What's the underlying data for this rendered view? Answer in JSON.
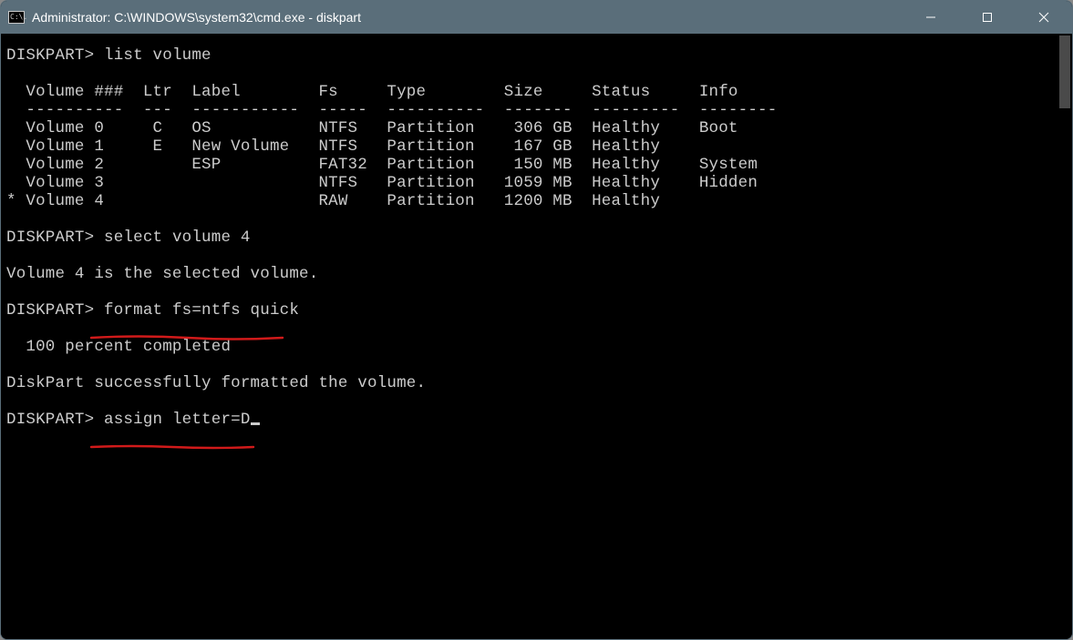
{
  "window": {
    "title": "Administrator: C:\\WINDOWS\\system32\\cmd.exe - diskpart",
    "icon_text": "C:\\."
  },
  "term": {
    "prompt": "DISKPART>",
    "cmd_list": "list volume",
    "header": "  Volume ###  Ltr  Label        Fs     Type        Size     Status     Info",
    "divider": "  ----------  ---  -----------  -----  ----------  -------  ---------  --------",
    "rows": [
      "  Volume 0     C   OS           NTFS   Partition    306 GB  Healthy    Boot",
      "  Volume 1     E   New Volume   NTFS   Partition    167 GB  Healthy",
      "  Volume 2         ESP          FAT32  Partition    150 MB  Healthy    System",
      "  Volume 3                      NTFS   Partition   1059 MB  Healthy    Hidden",
      "* Volume 4                      RAW    Partition   1200 MB  Healthy"
    ],
    "cmd_select": "select volume 4",
    "msg_selected": "Volume 4 is the selected volume.",
    "cmd_format": "format fs=ntfs quick",
    "msg_progress": "  100 percent completed",
    "msg_formatted": "DiskPart successfully formatted the volume.",
    "cmd_assign": "assign letter=D"
  },
  "annotations": {
    "color": "#d11a1a"
  }
}
